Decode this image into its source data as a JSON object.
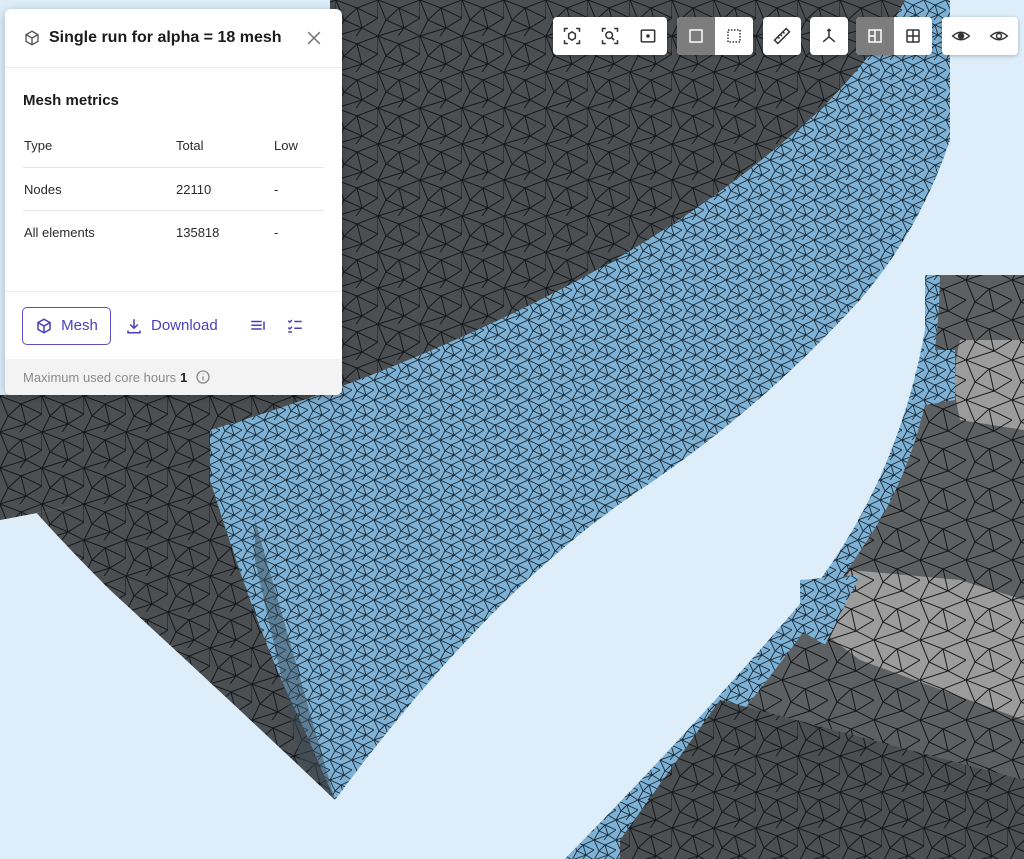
{
  "panel": {
    "title": "Single run for alpha = 18 mesh",
    "section_title": "Mesh metrics",
    "table": {
      "headers": [
        "Type",
        "Total",
        "Low"
      ],
      "rows": [
        [
          "Nodes",
          "22110",
          "-"
        ],
        [
          "All elements",
          "135818",
          "-"
        ]
      ]
    },
    "actions": {
      "mesh_label": "Mesh",
      "download_label": "Download"
    },
    "footer": {
      "label": "Maximum used core hours",
      "value": "1"
    }
  },
  "toolbar": {
    "groups": [
      [
        "fit-view-icon",
        "zoom-to-fit-icon",
        "focus-selection-icon"
      ],
      [
        "solid-view-icon",
        "dotted-outline-icon"
      ],
      [
        "ruler-icon"
      ],
      [
        "axes-icon"
      ],
      [
        "section-view-icon",
        "grid-view-icon"
      ],
      [
        "hide-eye-icon",
        "show-eye-icon"
      ]
    ],
    "active": [
      "solid-view-icon",
      "section-view-icon"
    ]
  },
  "colors": {
    "background": "#ddeefa",
    "mesh_dark": "#4a4e50",
    "mesh_blue": "#7fb2d6",
    "mesh_light": "#9a9a9a",
    "accent": "#4a3fb8"
  }
}
